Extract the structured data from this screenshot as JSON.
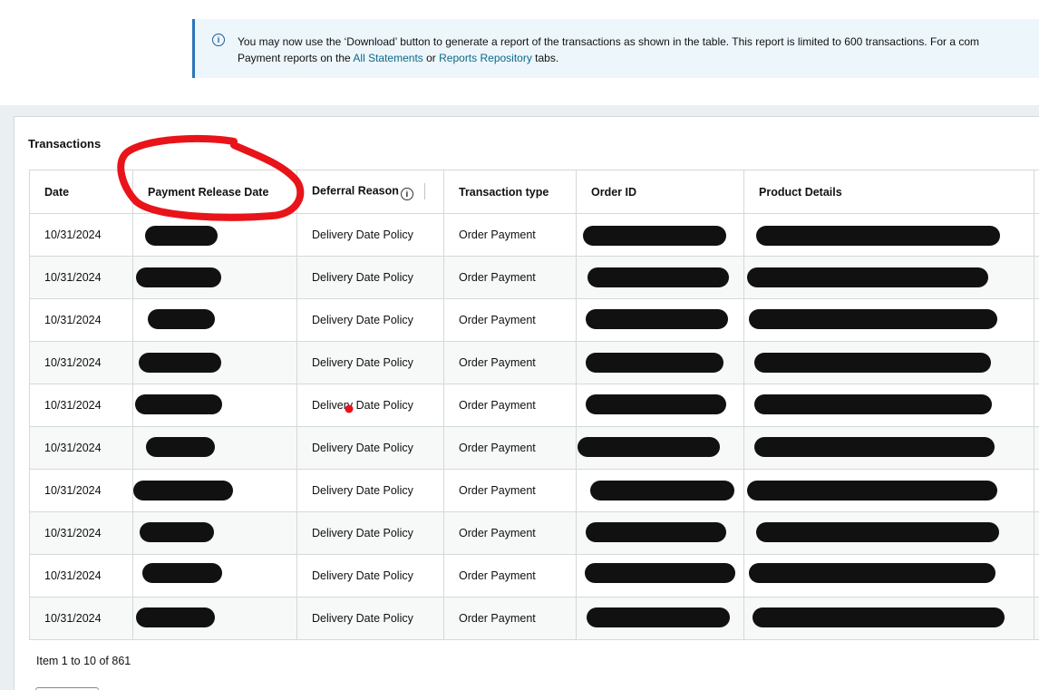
{
  "banner": {
    "line1": "You may now use the ‘Download’ button to generate a report of the transactions as shown in the table. This report is limited to 600 transactions. For a com",
    "line2_prefix": "Payment reports on the ",
    "link_all_statements": "All Statements",
    "line2_middle": " or ",
    "link_reports_repository": "Reports Repository",
    "line2_suffix": " tabs."
  },
  "transactions": {
    "title": "Transactions",
    "columns": [
      "Date",
      "Payment Release Date",
      "Deferral Reason",
      "Transaction type",
      "Order ID",
      "Product Details"
    ],
    "rows": [
      {
        "date": "10/31/2024",
        "deferral_reason": "Delivery Date Policy",
        "transaction_type": "Order Payment"
      },
      {
        "date": "10/31/2024",
        "deferral_reason": "Delivery Date Policy",
        "transaction_type": "Order Payment"
      },
      {
        "date": "10/31/2024",
        "deferral_reason": "Delivery Date Policy",
        "transaction_type": "Order Payment"
      },
      {
        "date": "10/31/2024",
        "deferral_reason": "Delivery Date Policy",
        "transaction_type": "Order Payment"
      },
      {
        "date": "10/31/2024",
        "deferral_reason": "Delivery Date Policy",
        "transaction_type": "Order Payment"
      },
      {
        "date": "10/31/2024",
        "deferral_reason": "Delivery Date Policy",
        "transaction_type": "Order Payment"
      },
      {
        "date": "10/31/2024",
        "deferral_reason": "Delivery Date Policy",
        "transaction_type": "Order Payment"
      },
      {
        "date": "10/31/2024",
        "deferral_reason": "Delivery Date Policy",
        "transaction_type": "Order Payment"
      },
      {
        "date": "10/31/2024",
        "deferral_reason": "Delivery Date Policy",
        "transaction_type": "Order Payment"
      },
      {
        "date": "10/31/2024",
        "deferral_reason": "Delivery Date Policy",
        "transaction_type": "Order Payment"
      }
    ]
  },
  "pagination": {
    "summary": "Item 1 to 10 of 861"
  },
  "icons": {
    "banner_icon": "info-icon",
    "deferral_icon": "info-icon"
  },
  "colors": {
    "banner_bg": "#edf6fb",
    "banner_border": "#2b75b9",
    "link": "#0b6a8a",
    "annotation": "#e8141a",
    "redaction": "#111111"
  }
}
